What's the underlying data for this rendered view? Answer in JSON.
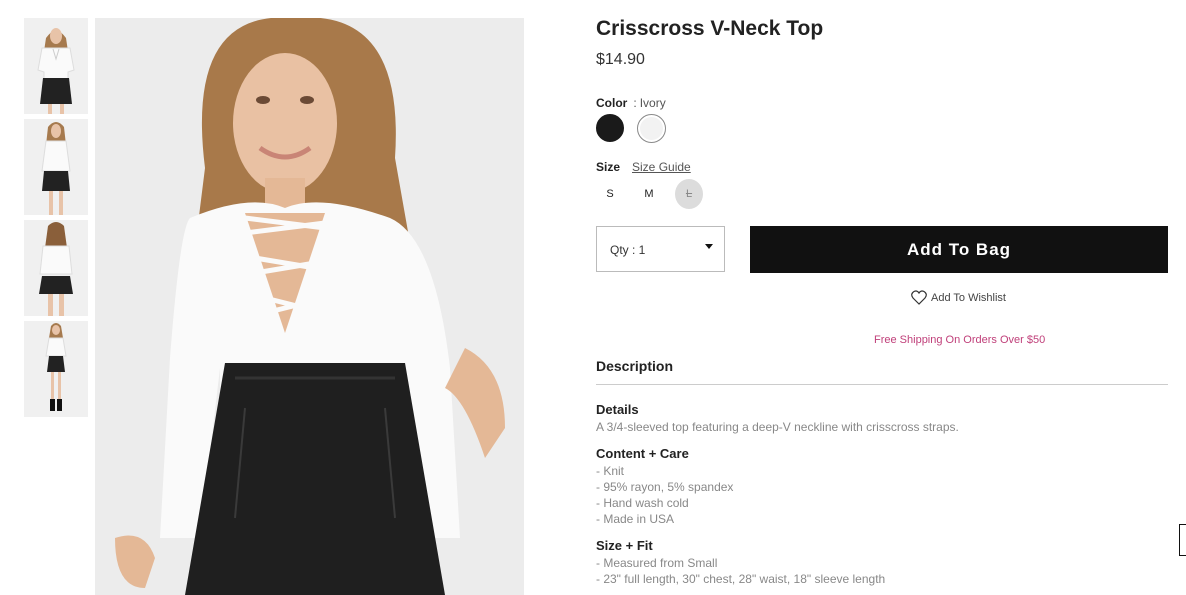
{
  "product": {
    "title": "Crisscross V-Neck Top",
    "price": "$14.90"
  },
  "color": {
    "label": "Color",
    "separator": ":",
    "selected": "Ivory",
    "swatches": [
      "#1a1a1a",
      "#f2f2f2"
    ]
  },
  "size": {
    "label": "Size",
    "guide_label": "Size Guide",
    "options": [
      "S",
      "M",
      "L"
    ],
    "unavailable": [
      "L"
    ]
  },
  "qty": {
    "label": "Qty : 1"
  },
  "add_to_bag": {
    "label": "Add To Bag"
  },
  "wishlist": {
    "label": "Add To Wishlist",
    "icon": "heart-icon"
  },
  "shipping_note": "Free Shipping On Orders Over $50",
  "description": {
    "heading": "Description",
    "details": {
      "heading": "Details",
      "text": "A 3/4-sleeved top featuring a deep-V neckline with crisscross straps."
    },
    "content_care": {
      "heading": "Content + Care",
      "lines": [
        "- Knit",
        "- 95% rayon, 5% spandex",
        "- Hand wash cold",
        "- Made in USA"
      ]
    },
    "size_fit": {
      "heading": "Size + Fit",
      "lines": [
        "- Measured from Small",
        "- 23\" full length, 30\" chest, 28\" waist, 18\" sleeve length"
      ]
    }
  },
  "colors": {
    "accent": "#c0407a",
    "button_bg": "#111111"
  }
}
